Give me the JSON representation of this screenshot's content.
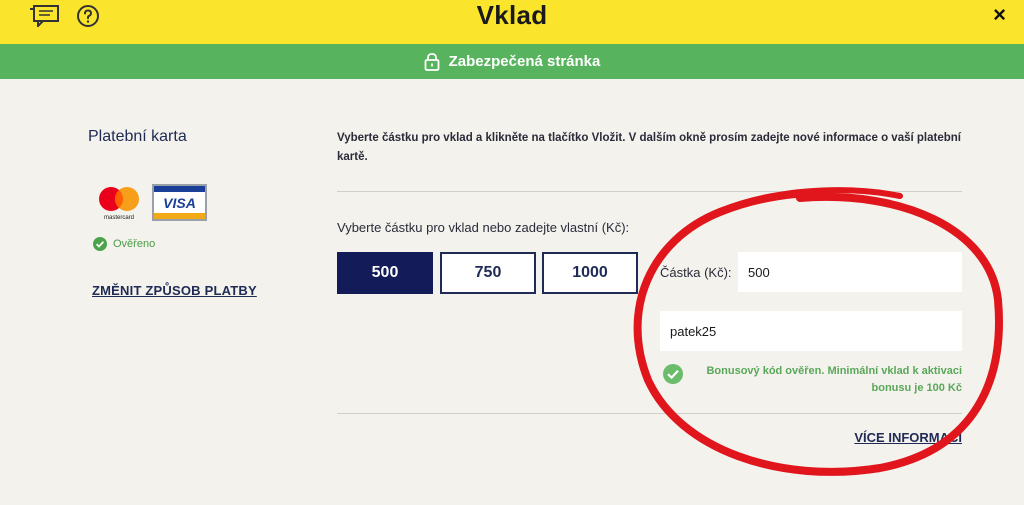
{
  "header": {
    "title": "Vklad",
    "close_label": "×",
    "background": "#fbe52c"
  },
  "secure_bar": {
    "text": "Zabezpečená stránka",
    "background": "#57b35d"
  },
  "payment_method": {
    "title": "Platební karta",
    "mastercard_wordmark": "mastercard",
    "visa_wordmark": "VISA",
    "verified_label": "Ověřeno",
    "change_link": "ZMĚNIT ZPŮSOB PLATBY"
  },
  "deposit": {
    "instructions": "Vyberte částku pro vklad a klikněte na tlačítko Vložit. V dalším okně prosím zadejte nové informace o vaší platební kartě.",
    "amount_prompt": "Vyberte částku pro vklad nebo zadejte vlastní (Kč):",
    "amount_options": [
      "500",
      "750",
      "1000"
    ],
    "selected_amount": "500",
    "amount_label": "Částka (Kč):",
    "amount_value": "500",
    "bonus_code": "patek25",
    "bonus_message_line1": "Bonusový kód ověřen. Minimální vklad k aktivaci",
    "bonus_message_line2": "bonusu je 100 Kč",
    "more_info_link": "VÍCE INFORMACÍ"
  },
  "colors": {
    "navy": "#131c58",
    "success_green": "#5aa75a",
    "annotation_red": "#e0161c"
  }
}
